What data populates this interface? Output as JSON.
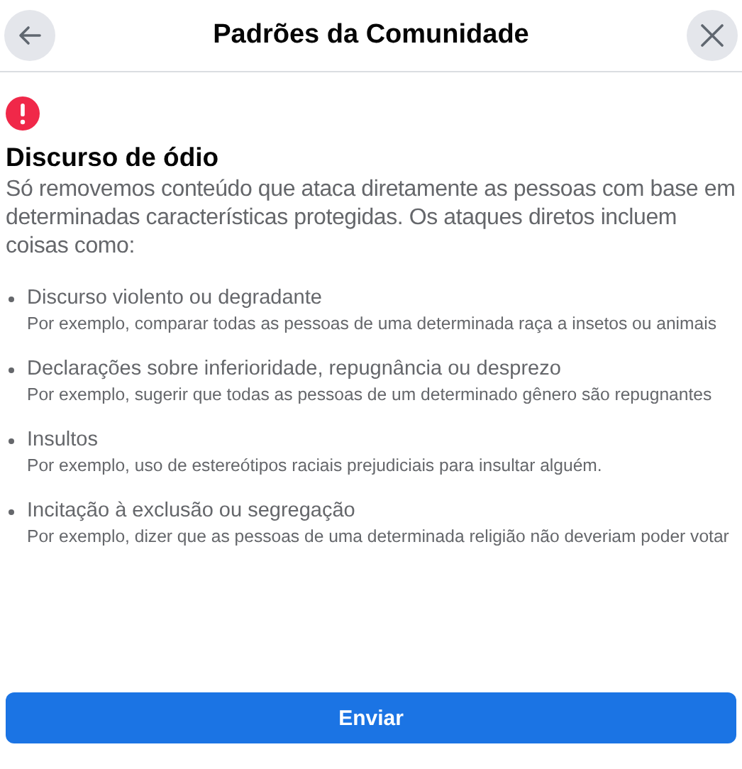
{
  "header": {
    "title": "Padrões da Comunidade"
  },
  "section": {
    "title": "Discurso de ódio",
    "description": "Só removemos conteúdo que ataca diretamente as pessoas com base em determinadas características protegidas. Os ataques diretos incluem coisas como:"
  },
  "items": [
    {
      "title": "Discurso violento ou degradante",
      "example": "Por exemplo, comparar todas as pessoas de uma determinada raça a insetos ou animais"
    },
    {
      "title": "Declarações sobre inferioridade, repugnância ou desprezo",
      "example": "Por exemplo, sugerir que todas as pessoas de um determinado gênero são repugnantes"
    },
    {
      "title": "Insultos",
      "example": "Por exemplo, uso de estereótipos raciais prejudiciais para insultar alguém."
    },
    {
      "title": "Incitação à exclusão ou segregação",
      "example": "Por exemplo, dizer que as pessoas de uma determinada religião não deveriam poder votar"
    }
  ],
  "button": {
    "label": "Enviar"
  }
}
